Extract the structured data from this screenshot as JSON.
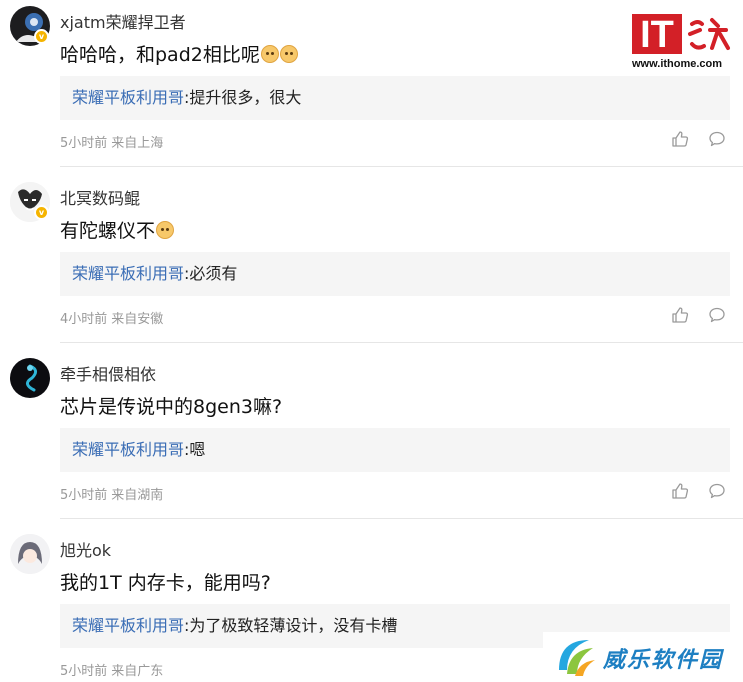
{
  "site_logo": {
    "mark_text": "IT",
    "url_text": "www.ithome.com"
  },
  "comments": [
    {
      "username": "xjatm荣耀捍卫者",
      "verified": true,
      "content": "哈哈哈，和pad2相比呢",
      "emoji_count": 2,
      "reply": {
        "name": "荣耀平板利用哥",
        "text": ":提升很多，很大"
      },
      "time": "5小时前",
      "location": "来自上海"
    },
    {
      "username": "北冥数码鲲",
      "verified": true,
      "content": "有陀螺仪不",
      "emoji_count": 1,
      "reply": {
        "name": "荣耀平板利用哥",
        "text": ":必须有"
      },
      "time": "4小时前",
      "location": "来自安徽"
    },
    {
      "username": "牵手相偎相依",
      "verified": false,
      "content": "芯片是传说中的8gen3嘛?",
      "emoji_count": 0,
      "reply": {
        "name": "荣耀平板利用哥",
        "text": ":嗯"
      },
      "time": "5小时前",
      "location": "来自湖南"
    },
    {
      "username": "旭光ok",
      "verified": false,
      "content": "我的1T 内存卡，能用吗?",
      "emoji_count": 0,
      "reply": {
        "name": "荣耀平板利用哥",
        "text": ":为了极致轻薄设计，没有卡槽"
      },
      "time": "5小时前",
      "location": "来自广东"
    }
  ],
  "watermark": {
    "text": "威乐软件园"
  },
  "colors": {
    "reply_name": "#3a6db5",
    "reply_bg": "#f5f5f5",
    "meta": "#999999",
    "logo_red": "#d32027",
    "verified": "#f5b400"
  },
  "icons": {
    "like": "thumbs-up-icon",
    "reply": "speech-bubble-icon"
  }
}
